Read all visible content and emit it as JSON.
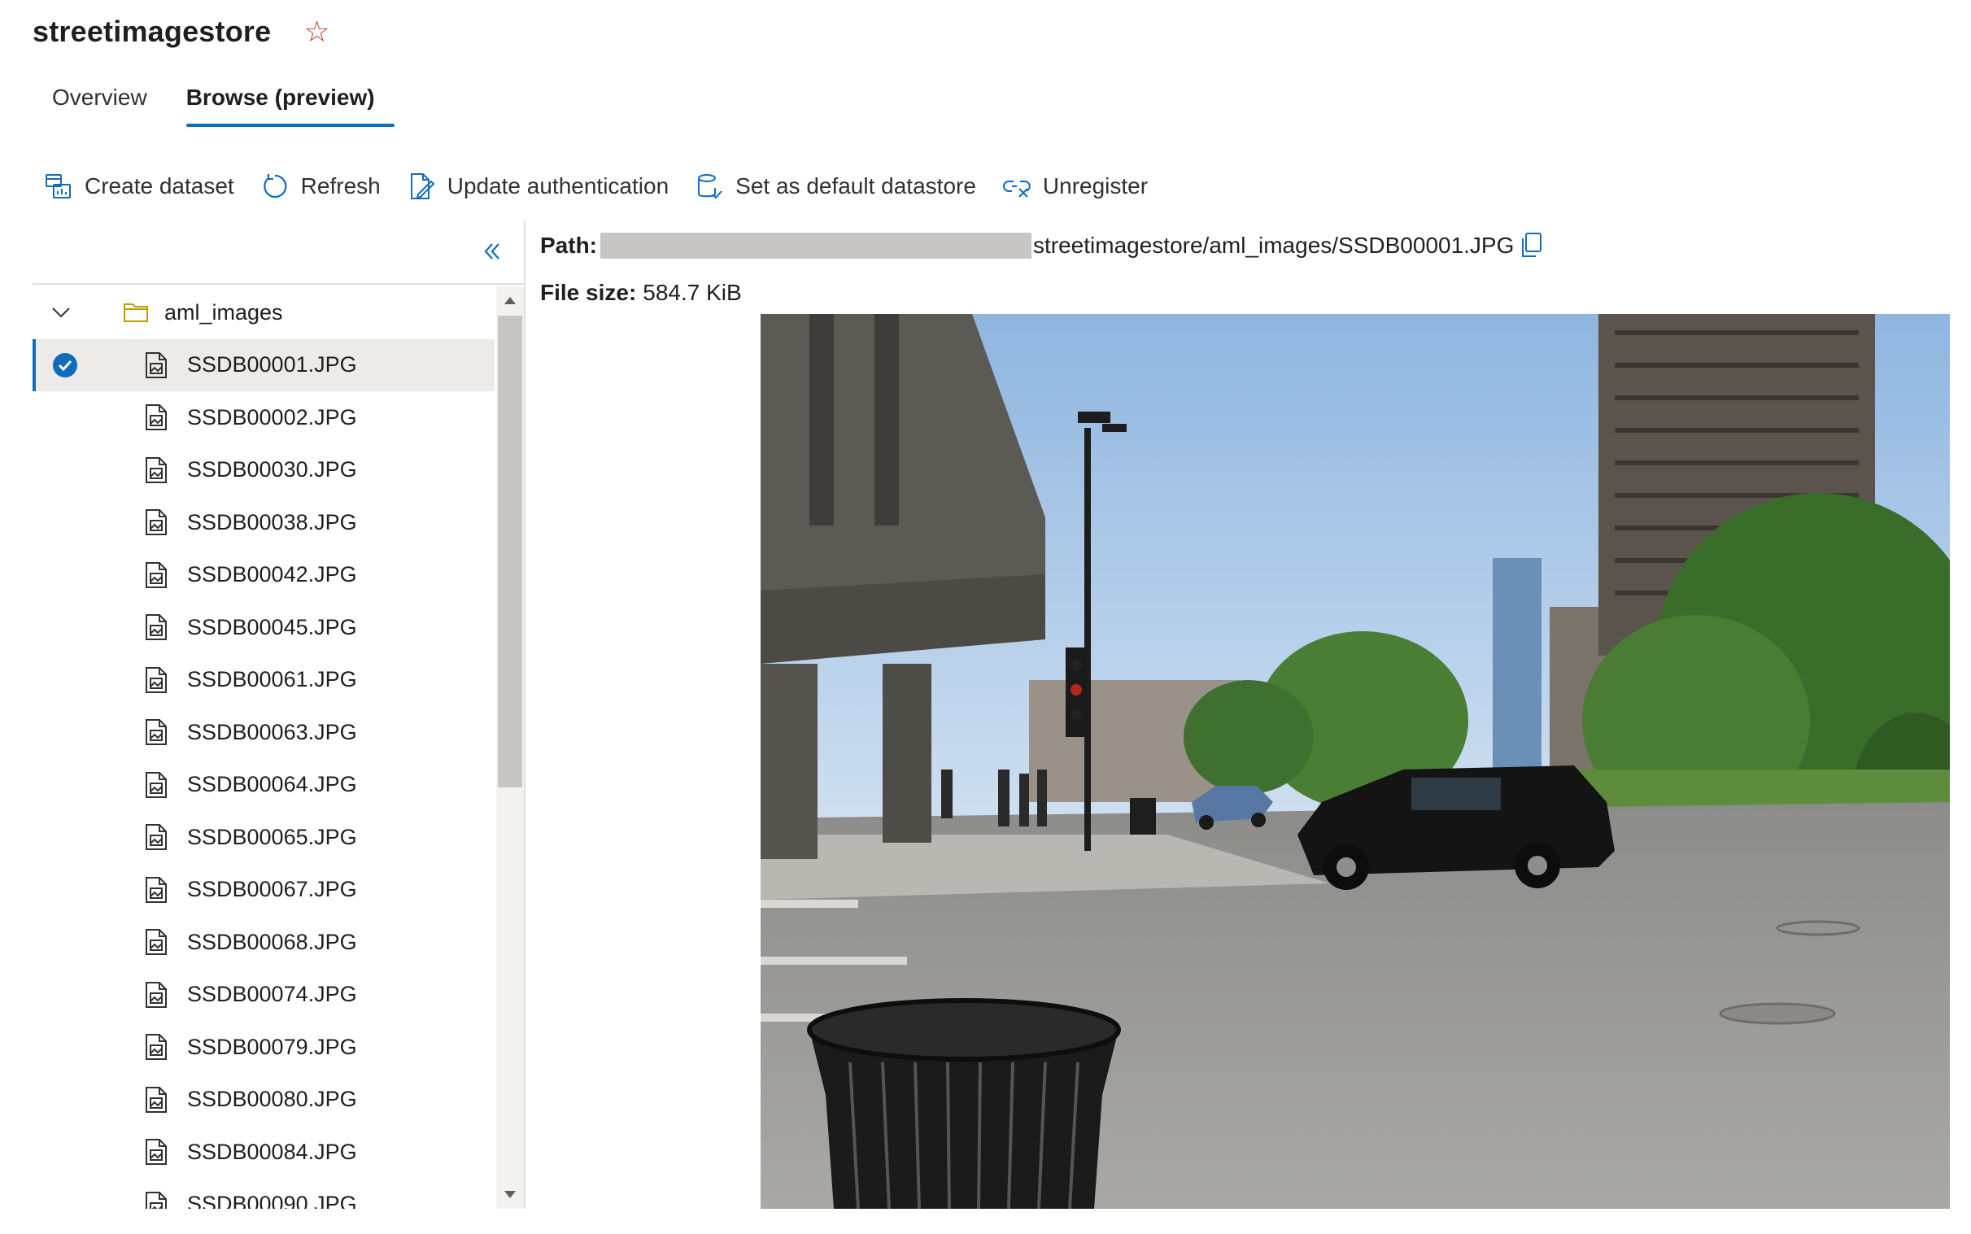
{
  "header": {
    "title": "streetimagestore",
    "favorite_icon": "star-outline-icon"
  },
  "tabs": [
    {
      "label": "Overview",
      "active": false
    },
    {
      "label": "Browse (preview)",
      "active": true
    }
  ],
  "toolbar": {
    "create_dataset": "Create dataset",
    "refresh": "Refresh",
    "update_authentication": "Update authentication",
    "set_default": "Set as default datastore",
    "unregister": "Unregister"
  },
  "tree": {
    "folder": "aml_images",
    "files": [
      "SSDB00001.JPG",
      "SSDB00002.JPG",
      "SSDB00030.JPG",
      "SSDB00038.JPG",
      "SSDB00042.JPG",
      "SSDB00045.JPG",
      "SSDB00061.JPG",
      "SSDB00063.JPG",
      "SSDB00064.JPG",
      "SSDB00065.JPG",
      "SSDB00067.JPG",
      "SSDB00068.JPG",
      "SSDB00074.JPG",
      "SSDB00079.JPG",
      "SSDB00080.JPG",
      "SSDB00084.JPG",
      "SSDB00090.JPG"
    ],
    "selected_index": 0
  },
  "details": {
    "path_label": "Path:",
    "path_value": "streetimagestore/aml_images/SSDB00001.JPG",
    "size_label": "File size:",
    "size_value": "584.7 KiB"
  },
  "colors": {
    "accent": "#0f6cbd",
    "star": "#c43c2c",
    "selected_bg": "#edebe9"
  }
}
